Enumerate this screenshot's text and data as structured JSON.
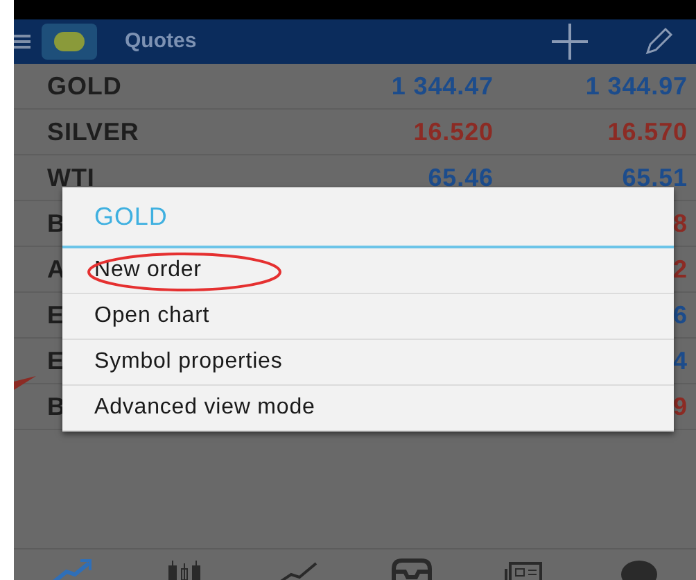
{
  "header": {
    "title": "Quotes"
  },
  "quotes": [
    {
      "symbol": "GOLD",
      "bid": {
        "text": "1 344.47",
        "color": "#1c4c8c"
      },
      "ask": {
        "text": "1 344.97",
        "color": "#1c4c8c"
      },
      "flagged": false
    },
    {
      "symbol": "SILVER",
      "bid": {
        "text": "16.520",
        "color": "#8c2b24"
      },
      "ask": {
        "text": "16.570",
        "color": "#8c2b24"
      },
      "flagged": false
    },
    {
      "symbol": "WTI",
      "bid": {
        "text": "65.46",
        "color": "#1c4c8c"
      },
      "ask": {
        "text": "65.51",
        "color": "#1c4c8c"
      },
      "flagged": false
    },
    {
      "symbol": "B",
      "ask": {
        "text": "8",
        "color": "#8c2b24"
      },
      "flagged": false
    },
    {
      "symbol": "A",
      "ask": {
        "text": "2",
        "color": "#8c2b24"
      },
      "flagged": false
    },
    {
      "symbol": "E",
      "ask": {
        "text": "6",
        "color": "#1c4c8c"
      },
      "flagged": false
    },
    {
      "symbol": "E",
      "ask": {
        "text": "4",
        "color": "#1c4c8c"
      },
      "flagged": false
    },
    {
      "symbol": "B",
      "ask": {
        "text": "9",
        "color": "#8c2b24"
      },
      "flagged": true
    }
  ],
  "dialog": {
    "title": "GOLD",
    "items": [
      {
        "label": "New order",
        "highlighted": true
      },
      {
        "label": "Open chart",
        "highlighted": false
      },
      {
        "label": "Symbol properties",
        "highlighted": false
      },
      {
        "label": "Advanced view mode",
        "highlighted": false
      }
    ]
  },
  "bottom_nav": [
    {
      "kind": "trade",
      "selected": true
    },
    {
      "kind": "candles",
      "selected": false
    },
    {
      "kind": "line",
      "selected": false
    },
    {
      "kind": "inbox",
      "selected": false
    },
    {
      "kind": "news",
      "selected": false
    },
    {
      "kind": "chat",
      "selected": false
    }
  ]
}
